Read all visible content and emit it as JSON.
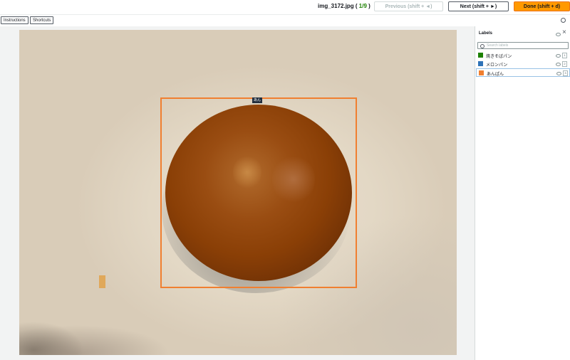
{
  "header": {
    "filename": "img_3172.jpg",
    "counter_prefix": " ( ",
    "counter_value": "1/9",
    "counter_suffix": " )",
    "prev_label": "Previous (shift + ◄)",
    "next_label": "Next (shift + ►)",
    "done_label": "Done (shift + d)"
  },
  "toolbar": {
    "instructions_label": "Instructions",
    "shortcuts_label": "Shortcuts"
  },
  "canvas": {
    "box_label": "あん"
  },
  "labels_panel": {
    "title": "Labels",
    "search_placeholder": "Search labels",
    "items": [
      {
        "name": "焼きそばパン",
        "color": "#1d8102",
        "key": "1"
      },
      {
        "name": "メロンパン",
        "color": "#2e73b8",
        "key": "2"
      },
      {
        "name": "あんぱん",
        "color": "#f07f30",
        "key": "3"
      }
    ]
  },
  "colors": {
    "accent": "#ff9900",
    "bbox": "#f07f30"
  }
}
